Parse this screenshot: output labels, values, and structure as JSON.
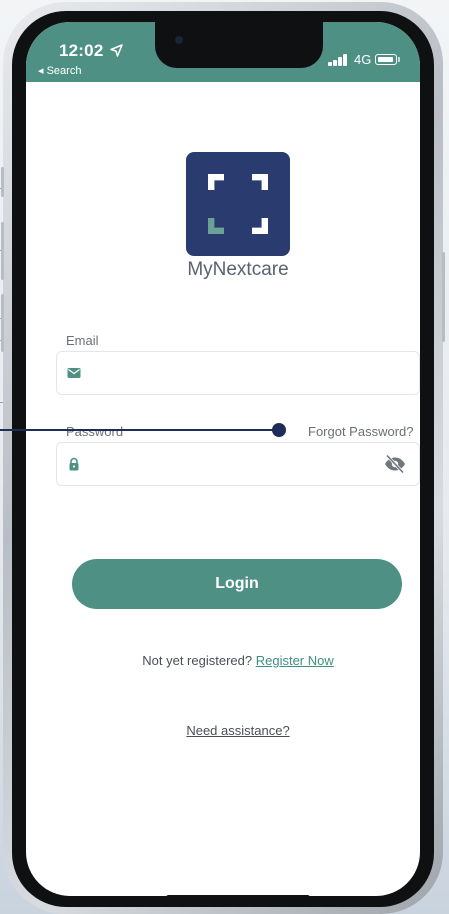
{
  "status_bar": {
    "time": "12:02",
    "back_label": "◂ Search",
    "network": "4G"
  },
  "brand": {
    "name": "MyNextcare",
    "logo_color": "#2a3b6f",
    "logo_accent": "#6aa396"
  },
  "login_form": {
    "email_label": "Email",
    "email_value": "",
    "password_label": "Password",
    "password_value": "",
    "forgot_label": "Forgot Password?",
    "login_label": "Login"
  },
  "footer": {
    "register_prompt": "Not yet registered?",
    "register_link": "Register Now",
    "assist_link": "Need assistance?"
  },
  "colors": {
    "accent": "#4e9184",
    "callout": "#1d2d58"
  },
  "icons": {
    "email": "mail-icon",
    "password": "lock-icon",
    "visibility": "eye-off-icon",
    "location": "location-arrow-icon"
  }
}
